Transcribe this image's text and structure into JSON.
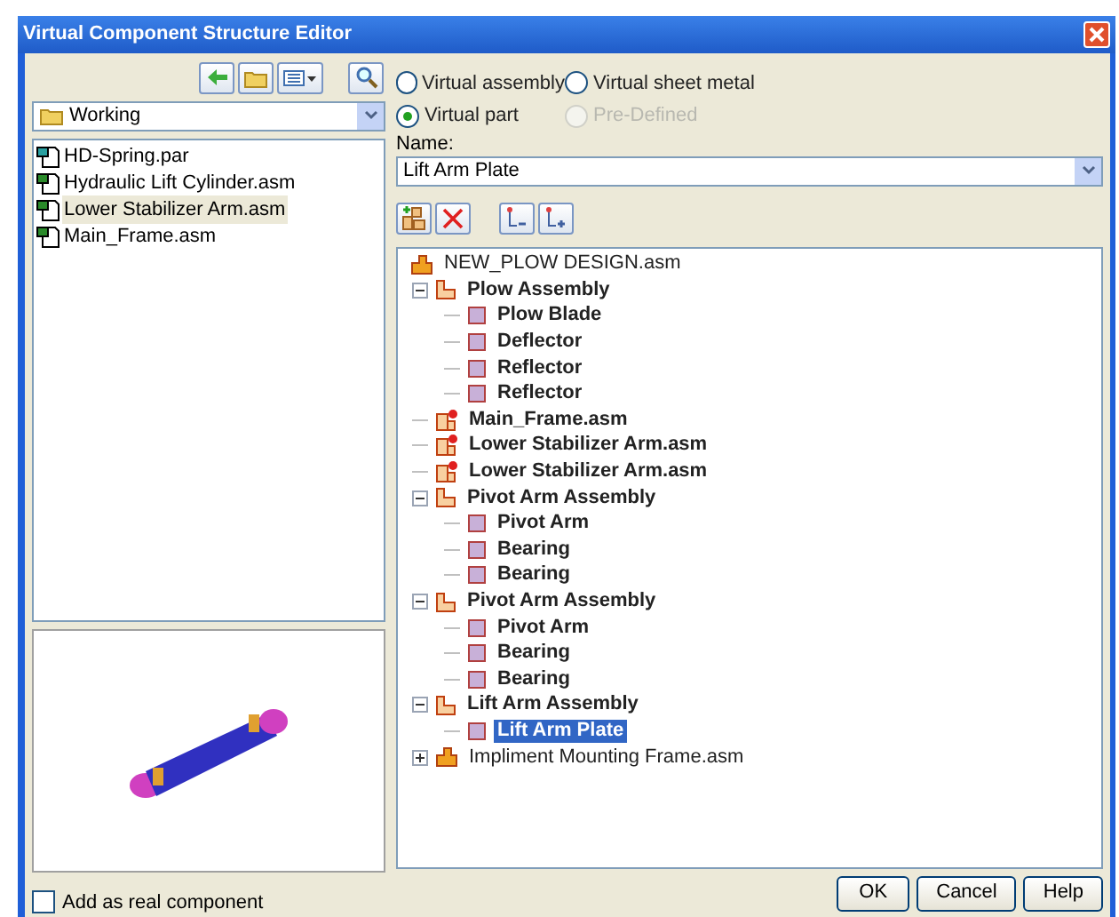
{
  "window": {
    "title": "Virtual Component Structure Editor"
  },
  "folder": {
    "value": "Working"
  },
  "files": [
    {
      "name": "HD-Spring.par",
      "kind": "part",
      "selected": false
    },
    {
      "name": "Hydraulic Lift Cylinder.asm",
      "kind": "assembly",
      "selected": false
    },
    {
      "name": "Lower Stabilizer Arm.asm",
      "kind": "assembly",
      "selected": true
    },
    {
      "name": "Main_Frame.asm",
      "kind": "assembly",
      "selected": false
    }
  ],
  "add_as_real": {
    "label": "Add as real component",
    "checked": false
  },
  "types": [
    {
      "label": "Virtual assembly",
      "selected": false,
      "disabled": false
    },
    {
      "label": "Virtual sheet metal",
      "selected": false,
      "disabled": false
    },
    {
      "label": "Virtual part",
      "selected": true,
      "disabled": false
    },
    {
      "label": "Pre-Defined",
      "selected": false,
      "disabled": true
    }
  ],
  "name": {
    "label": "Name:",
    "value": "Lift Arm Plate"
  },
  "tree": {
    "label": "NEW_PLOW DESIGN.asm",
    "kind": "root",
    "selected": false,
    "children": [
      {
        "label": "Plow Assembly",
        "kind": "virtual-assembly",
        "expanded": true,
        "selected": false,
        "children": [
          {
            "label": "Plow Blade",
            "kind": "virtual-part",
            "selected": false
          },
          {
            "label": "Deflector",
            "kind": "virtual-part",
            "selected": false
          },
          {
            "label": "Reflector",
            "kind": "virtual-part",
            "selected": false
          },
          {
            "label": "Reflector",
            "kind": "virtual-part",
            "selected": false
          }
        ]
      },
      {
        "label": "Main_Frame.asm",
        "kind": "added",
        "selected": false
      },
      {
        "label": "Lower Stabilizer Arm.asm",
        "kind": "added",
        "selected": false
      },
      {
        "label": "Lower Stabilizer Arm.asm",
        "kind": "added",
        "selected": false
      },
      {
        "label": "Pivot Arm Assembly",
        "kind": "virtual-assembly",
        "expanded": true,
        "selected": false,
        "children": [
          {
            "label": "Pivot Arm",
            "kind": "virtual-part",
            "selected": false
          },
          {
            "label": "Bearing",
            "kind": "virtual-part",
            "selected": false
          },
          {
            "label": "Bearing",
            "kind": "virtual-part",
            "selected": false
          }
        ]
      },
      {
        "label": "Pivot Arm Assembly",
        "kind": "virtual-assembly",
        "expanded": true,
        "selected": false,
        "children": [
          {
            "label": "Pivot Arm",
            "kind": "virtual-part",
            "selected": false
          },
          {
            "label": "Bearing",
            "kind": "virtual-part",
            "selected": false
          },
          {
            "label": "Bearing",
            "kind": "virtual-part",
            "selected": false
          }
        ]
      },
      {
        "label": "Lift Arm Assembly",
        "kind": "virtual-assembly",
        "expanded": true,
        "selected": false,
        "children": [
          {
            "label": "Lift Arm Plate",
            "kind": "virtual-part",
            "selected": true
          }
        ]
      },
      {
        "label": "Impliment Mounting Frame.asm",
        "kind": "root",
        "expanded": false,
        "selected": false
      }
    ]
  },
  "buttons": [
    "OK",
    "Cancel",
    "Help"
  ]
}
